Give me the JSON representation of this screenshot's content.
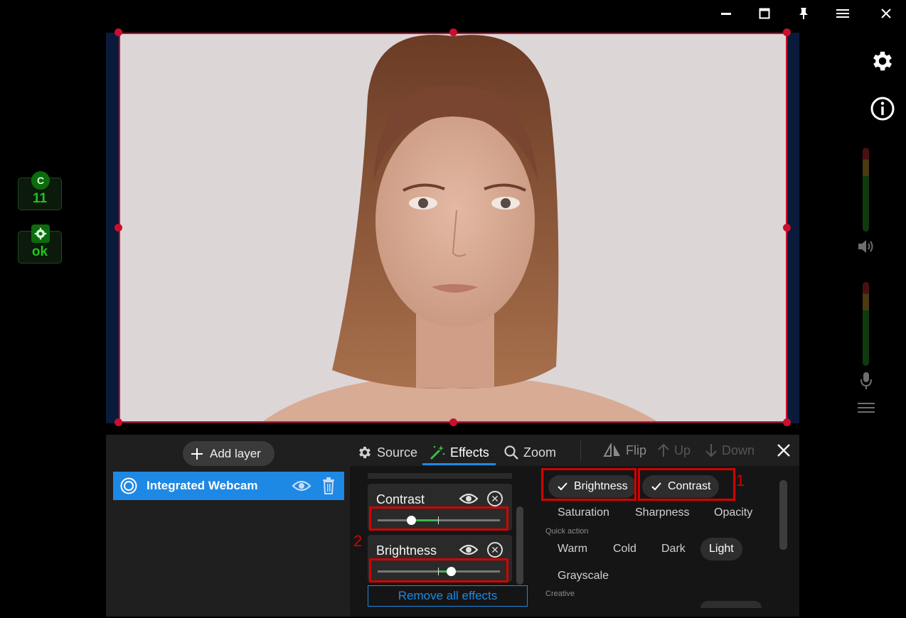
{
  "window": {
    "controls": [
      "minimize-icon",
      "maximize-icon",
      "pin-icon",
      "menu-icon",
      "close-icon"
    ]
  },
  "status": {
    "camera_badge_letter": "C",
    "camera_badge_value": "11",
    "system_badge_value": "ok"
  },
  "side": {
    "icons": [
      "gear-icon",
      "info-icon",
      "speaker-icon",
      "microphone-icon",
      "hamburger-icon"
    ]
  },
  "layers": {
    "add_label": "Add layer",
    "items": [
      {
        "label": "Integrated Webcam"
      }
    ]
  },
  "tabs": [
    {
      "label": "Source",
      "icon": "gear-icon"
    },
    {
      "label": "Effects",
      "icon": "magic-wand-icon"
    },
    {
      "label": "Zoom",
      "icon": "search-icon"
    }
  ],
  "toolbar": {
    "flip": "Flip",
    "up": "Up",
    "down": "Down"
  },
  "effects": {
    "active": [
      {
        "label": "Contrast",
        "value": -0.45
      },
      {
        "label": "Brightness",
        "value": 0.2
      }
    ],
    "remove_all": "Remove all effects",
    "toggles": {
      "brightness": "Brightness",
      "contrast": "Contrast"
    },
    "adjust": [
      "Saturation",
      "Sharpness",
      "Opacity"
    ],
    "quick_action_label": "Quick action",
    "quick_actions": [
      "Warm",
      "Cold",
      "Dark",
      "Light"
    ],
    "selected_quick_action": "Light",
    "grayscale": "Grayscale",
    "creative_label": "Creative"
  },
  "annotations": {
    "marker_1": "1",
    "marker_2": "2"
  },
  "colors": {
    "accent": "#1e88e5",
    "selection": "#c8102e",
    "annotation": "#d40000",
    "slider_active": "#3cb84a",
    "status_green": "#22c322"
  }
}
